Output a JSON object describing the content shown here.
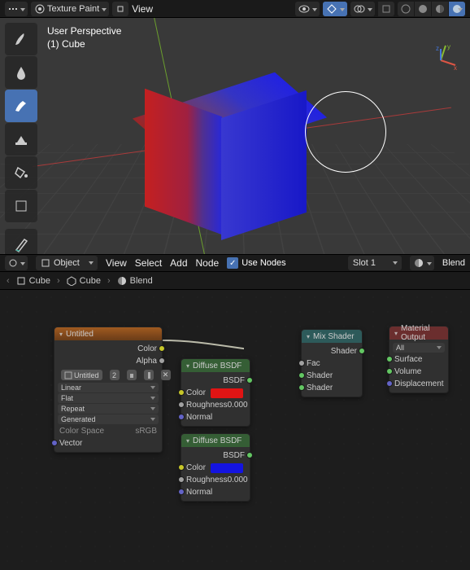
{
  "header": {
    "mode_label": "Texture Paint",
    "view_label": "View"
  },
  "viewport": {
    "perspective": "User Perspective",
    "object_name": "(1) Cube"
  },
  "node_header": {
    "mode": "Object",
    "menu_view": "View",
    "menu_select": "Select",
    "menu_add": "Add",
    "menu_node": "Node",
    "use_nodes_label": "Use Nodes",
    "slot": "Slot 1",
    "material": "Blend"
  },
  "breadcrumb": {
    "obj": "Cube",
    "mesh": "Cube",
    "mat": "Blend"
  },
  "nodes": {
    "tex": {
      "title": "Untitled",
      "out_color": "Color",
      "out_alpha": "Alpha",
      "image_name": "Untitled",
      "users": "2",
      "interp": "Linear",
      "proj": "Flat",
      "ext": "Repeat",
      "source": "Generated",
      "cs_label": "Color Space",
      "cs_value": "sRGB",
      "in_vector": "Vector"
    },
    "diff1": {
      "title": "Diffuse BSDF",
      "out_bsdf": "BSDF",
      "in_color": "Color",
      "rough_label": "Roughness",
      "rough_val": "0.000",
      "in_normal": "Normal",
      "color_hex": "#e01414"
    },
    "diff2": {
      "title": "Diffuse BSDF",
      "out_bsdf": "BSDF",
      "in_color": "Color",
      "rough_label": "Roughness",
      "rough_val": "0.000",
      "in_normal": "Normal",
      "color_hex": "#1414e0"
    },
    "mix": {
      "title": "Mix Shader",
      "out_shader": "Shader",
      "in_fac": "Fac",
      "in_sh1": "Shader",
      "in_sh2": "Shader"
    },
    "output": {
      "title": "Material Output",
      "target": "All",
      "in_surface": "Surface",
      "in_volume": "Volume",
      "in_disp": "Displacement"
    }
  }
}
